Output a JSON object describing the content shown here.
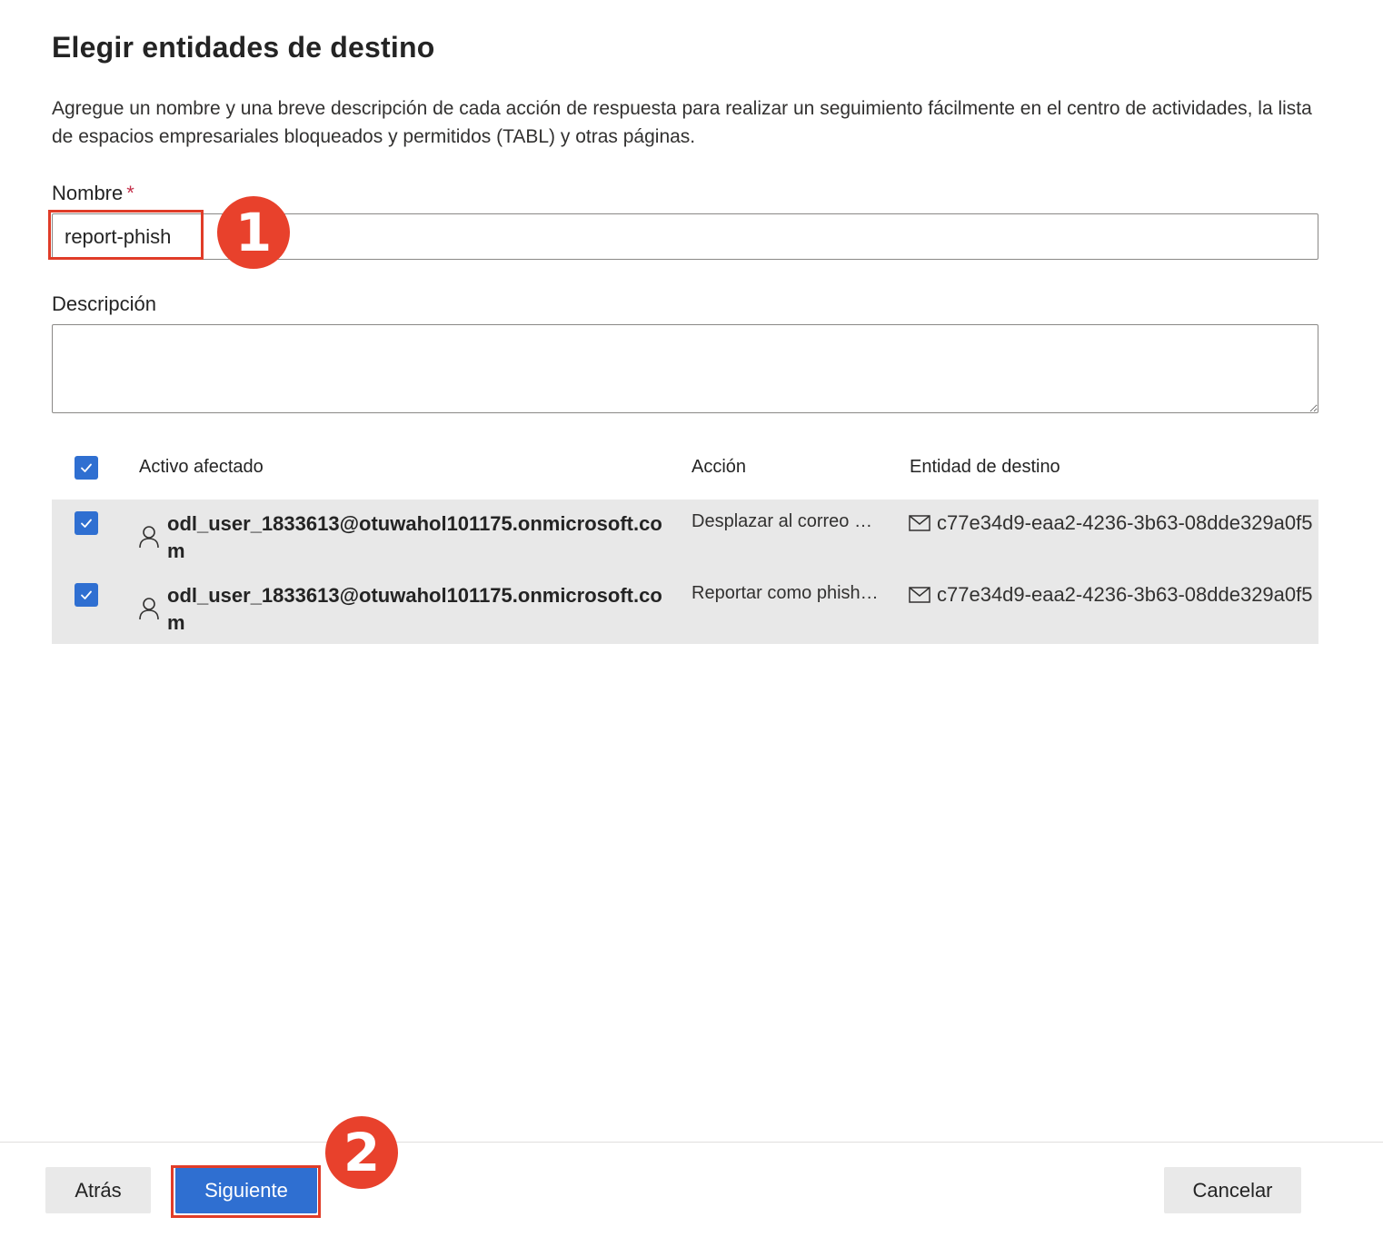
{
  "title": "Elegir entidades de destino",
  "description": "Agregue un nombre y una breve descripción de cada acción de respuesta para realizar un seguimiento fácilmente en el centro de actividades, la lista de espacios empresariales bloqueados y permitidos (TABL) y otras páginas.",
  "name_field": {
    "label": "Nombre",
    "required_marker": "*",
    "value": "report-phish"
  },
  "description_field": {
    "label": "Descripción",
    "value": ""
  },
  "table": {
    "headers": {
      "asset": "Activo afectado",
      "action": "Acción",
      "entity": "Entidad de destino"
    },
    "select_all_checked": true,
    "rows": [
      {
        "checked": true,
        "asset": "odl_user_1833613@otuwahol101175.onmicrosoft.com",
        "action": "Desplazar al correo no...",
        "entity": "c77e34d9-eaa2-4236-3b63-08dde329a0f5"
      },
      {
        "checked": true,
        "asset": "odl_user_1833613@otuwahol101175.onmicrosoft.com",
        "action": "Reportar como phishing",
        "entity": "c77e34d9-eaa2-4236-3b63-08dde329a0f5"
      }
    ]
  },
  "annotations": {
    "step1": "1",
    "step2": "2"
  },
  "footer": {
    "back_label": "Atrás",
    "next_label": "Siguiente",
    "cancel_label": "Cancelar"
  },
  "colors": {
    "accent": "#2f6fd1",
    "annotation": "#e8412c",
    "row_background": "#e8e8e8",
    "required": "#c4314b"
  },
  "icons": {
    "checkbox": "checkmark-icon",
    "asset": "user-icon",
    "entity": "mail-icon"
  }
}
